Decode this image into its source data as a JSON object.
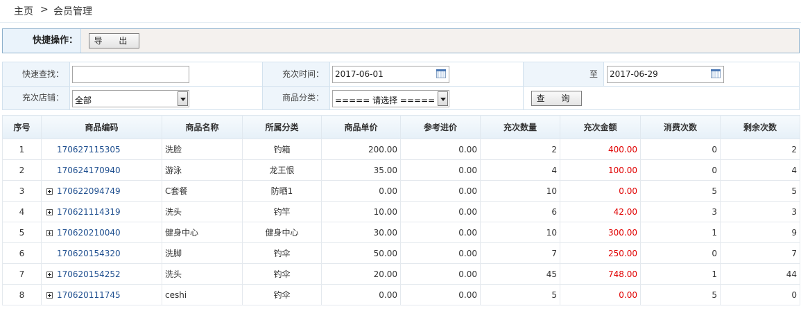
{
  "breadcrumb": {
    "home": "主页",
    "sep": ">",
    "current": "会员管理"
  },
  "quickbar": {
    "label": "快捷操作：",
    "export_label": "导 出"
  },
  "filters": {
    "quick_search_label": "快速查找：",
    "quick_search_value": "",
    "time_label": "充次时间：",
    "date_from": "2017-06-01",
    "to_label": "至",
    "date_to": "2017-06-29",
    "store_label": "充次店铺：",
    "store_value": "全部",
    "category_label": "商品分类：",
    "category_value": "===== 请选择 =====",
    "query_label": "查 询"
  },
  "table": {
    "headers": [
      "序号",
      "商品编码",
      "商品名称",
      "所属分类",
      "商品单价",
      "参考进价",
      "充次数量",
      "充次金额",
      "消费次数",
      "剩余次数"
    ],
    "rows": [
      {
        "no": "1",
        "code": "170627115305",
        "name": "洗脸",
        "category": "钓箱",
        "price": "200.00",
        "cost": "0.00",
        "qty": "2",
        "amount": "400.00",
        "used": "0",
        "remain": "2",
        "expand": false
      },
      {
        "no": "2",
        "code": "170624170940",
        "name": "游泳",
        "category": "龙王恨",
        "price": "35.00",
        "cost": "0.00",
        "qty": "4",
        "amount": "100.00",
        "used": "0",
        "remain": "4",
        "expand": false
      },
      {
        "no": "3",
        "code": "170622094749",
        "name": "C套餐",
        "category": "防晒1",
        "price": "0.00",
        "cost": "0.00",
        "qty": "10",
        "amount": "0.00",
        "used": "5",
        "remain": "5",
        "expand": true
      },
      {
        "no": "4",
        "code": "170621114319",
        "name": "洗头",
        "category": "钓竿",
        "price": "10.00",
        "cost": "0.00",
        "qty": "6",
        "amount": "42.00",
        "used": "3",
        "remain": "3",
        "expand": true
      },
      {
        "no": "5",
        "code": "170620210040",
        "name": "健身中心",
        "category": "健身中心",
        "price": "30.00",
        "cost": "0.00",
        "qty": "10",
        "amount": "300.00",
        "used": "1",
        "remain": "9",
        "expand": true
      },
      {
        "no": "6",
        "code": "170620154320",
        "name": "洗脚",
        "category": "钓伞",
        "price": "50.00",
        "cost": "0.00",
        "qty": "7",
        "amount": "250.00",
        "used": "0",
        "remain": "7",
        "expand": false
      },
      {
        "no": "7",
        "code": "170620154252",
        "name": "洗头",
        "category": "钓伞",
        "price": "20.00",
        "cost": "0.00",
        "qty": "45",
        "amount": "748.00",
        "used": "1",
        "remain": "44",
        "expand": true
      },
      {
        "no": "8",
        "code": "170620111745",
        "name": "ceshi",
        "category": "钓伞",
        "price": "0.00",
        "cost": "0.00",
        "qty": "5",
        "amount": "0.00",
        "used": "5",
        "remain": "0",
        "expand": true
      }
    ]
  },
  "colors": {
    "amount": "#e00000",
    "code_link": "#1f4f8f",
    "header_bg": "#eaf3fb",
    "border": "#8fb1cc"
  }
}
